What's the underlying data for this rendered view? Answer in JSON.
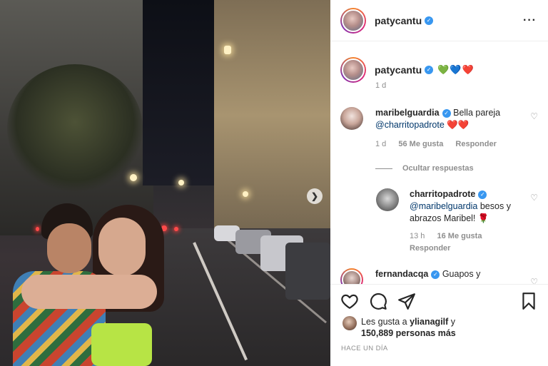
{
  "post": {
    "author": "patycantu"
  },
  "caption": {
    "author": "patycantu",
    "emojis": "💚💙❤️",
    "time": "1 d"
  },
  "comments": [
    {
      "user": "maribelguardia",
      "text": "Bella pareja",
      "mention": "@charritopadrote",
      "emojis": "❤️❤️",
      "time": "1 d",
      "likes": "56 Me gusta",
      "reply_label": "Responder"
    },
    {
      "user": "charritopadrote",
      "mention": "@maribelguardia",
      "text": "besos y abrazos Maribel!",
      "emojis": "🌹",
      "time": "13 h",
      "likes": "16 Me gusta",
      "reply_label": "Responder"
    },
    {
      "user": "fernandacqa",
      "text": "Guapos y"
    }
  ],
  "hide_replies_label": "Ocultar respuestas",
  "likes_summary": {
    "prefix": "Les gusta a",
    "user": "ylianagilf",
    "conj": "y",
    "count": "150,889 personas más"
  },
  "posted_time": "HACE UN DÍA",
  "icons": {
    "verified": "verified-badge-icon",
    "more": "more-options-icon",
    "like": "heart-icon",
    "comment": "comment-icon",
    "share": "share-icon",
    "save": "bookmark-icon",
    "next": "chevron-right-icon"
  },
  "colors": {
    "verified": "#3897f0",
    "mention": "#00376b",
    "muted": "#8e8e8e",
    "heart_red": "#ed4956"
  }
}
